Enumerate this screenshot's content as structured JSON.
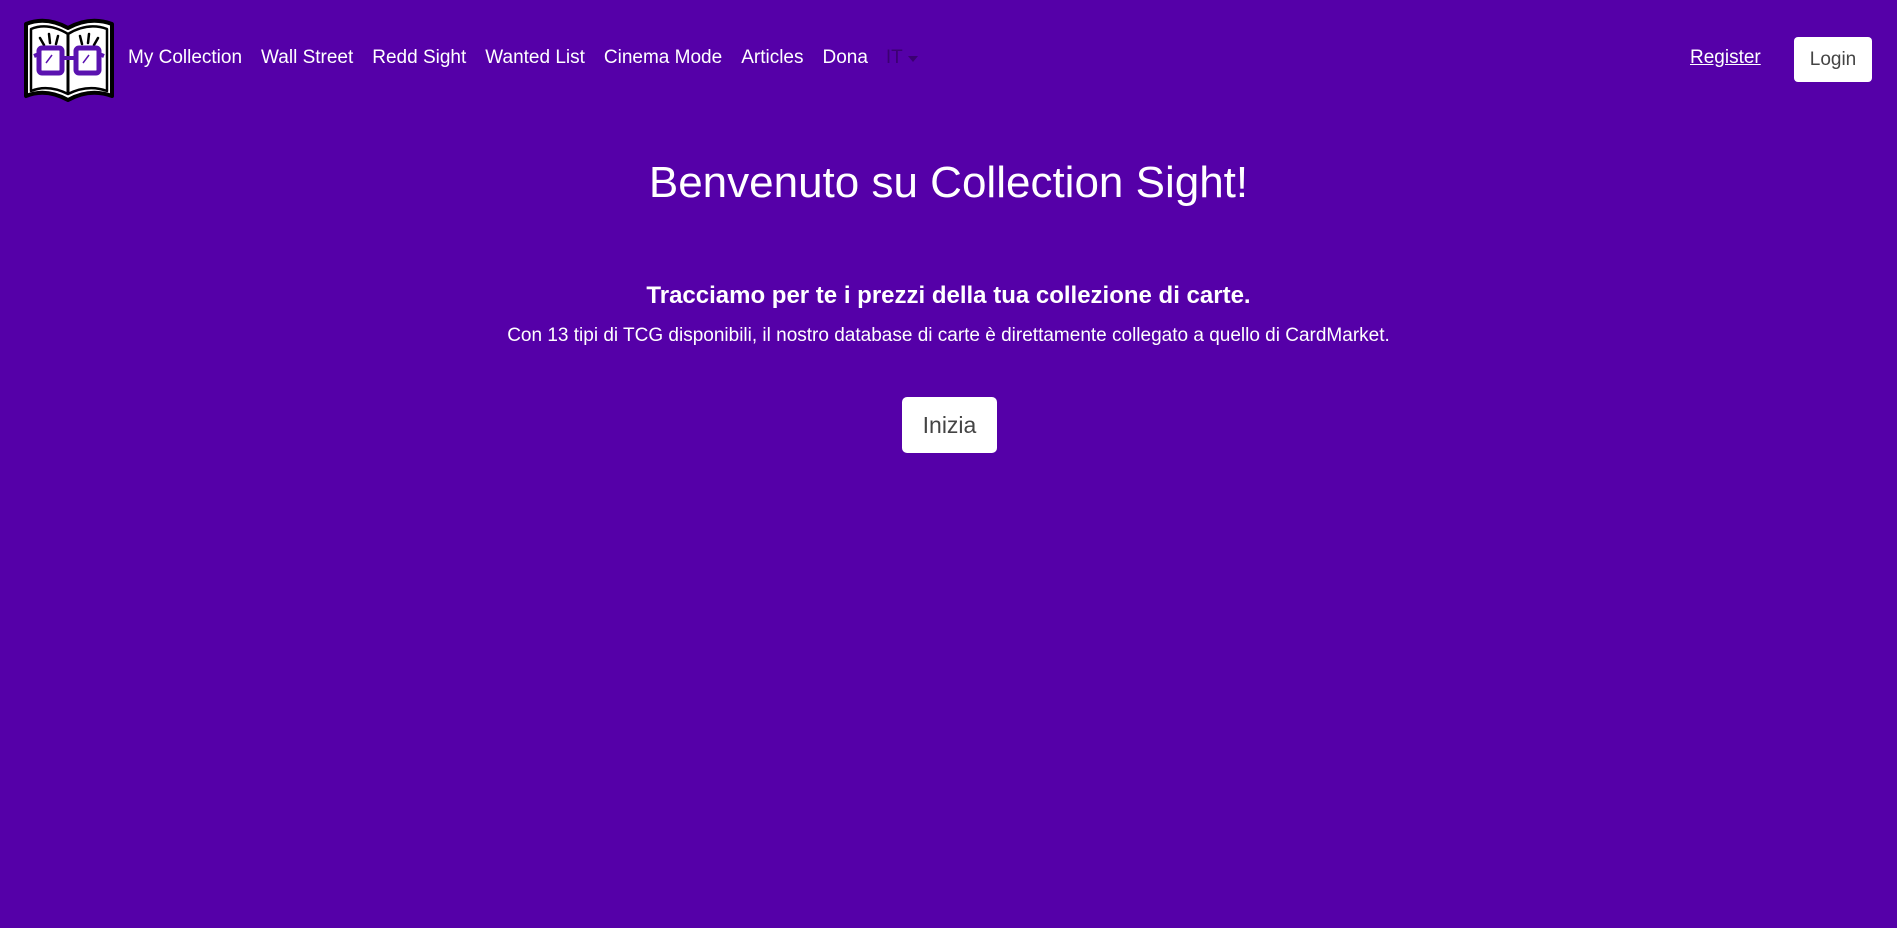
{
  "colors": {
    "background": "#5500a8",
    "text": "#ffffff",
    "button_bg": "#ffffff",
    "button_text": "#444444",
    "logo_accent": "#5a12b0"
  },
  "logo": {
    "icon": "open-book-glasses-logo"
  },
  "nav": {
    "items": [
      {
        "label": "My Collection"
      },
      {
        "label": "Wall Street"
      },
      {
        "label": "Redd Sight"
      },
      {
        "label": "Wanted List"
      },
      {
        "label": "Cinema Mode"
      },
      {
        "label": "Articles"
      },
      {
        "label": "Dona"
      }
    ],
    "language": {
      "label": "IT",
      "icon": "chevron-down-icon"
    },
    "register_label": "Register",
    "login_label": "Login"
  },
  "hero": {
    "title": "Benvenuto su Collection Sight!",
    "subtitle": "Tracciamo per te i prezzi della tua collezione di carte.",
    "text": "Con 13 tipi di TCG disponibili, il nostro database di carte è direttamente collegato a quello di CardMarket.",
    "cta_label": "Inizia"
  }
}
